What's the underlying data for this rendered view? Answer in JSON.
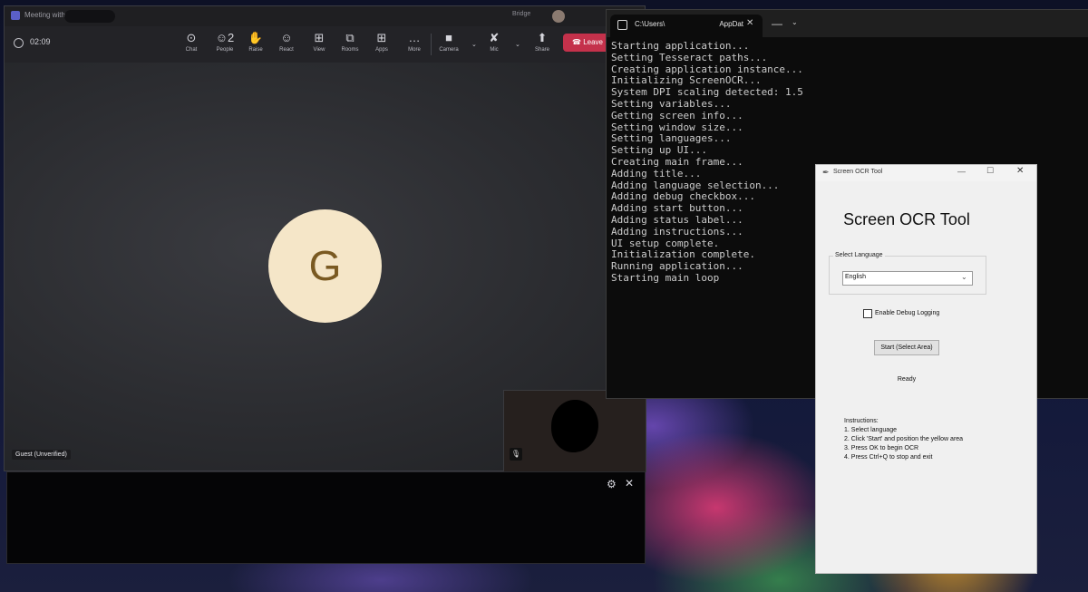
{
  "teams": {
    "window_title": "Meeting with",
    "user_name": "Bridge",
    "timer": "02:09",
    "toolbar": [
      {
        "name": "chat",
        "label": "Chat",
        "icon": "chat-icon",
        "glyph": "⊙"
      },
      {
        "name": "people",
        "label": "People",
        "icon": "people-icon",
        "glyph": "☺2"
      },
      {
        "name": "raise",
        "label": "Raise",
        "icon": "hand-icon",
        "glyph": "✋"
      },
      {
        "name": "react",
        "label": "React",
        "icon": "smiley-icon",
        "glyph": "☺"
      },
      {
        "name": "view",
        "label": "View",
        "icon": "grid-icon",
        "glyph": "⊞"
      },
      {
        "name": "rooms",
        "label": "Rooms",
        "icon": "rooms-icon",
        "glyph": "⧉"
      },
      {
        "name": "apps",
        "label": "Apps",
        "icon": "apps-icon",
        "glyph": "⊞"
      },
      {
        "name": "more",
        "label": "More",
        "icon": "more-icon",
        "glyph": "…"
      },
      {
        "name": "camera",
        "label": "Camera",
        "icon": "camera-icon",
        "glyph": "■"
      },
      {
        "name": "mic",
        "label": "Mic",
        "icon": "mic-off-icon",
        "glyph": "✘"
      },
      {
        "name": "share",
        "label": "Share",
        "icon": "share-icon",
        "glyph": "⬆"
      }
    ],
    "leave_label": "Leave",
    "leave_color": "#c4314b",
    "avatar_initial": "G",
    "participant_label": "Guest (Unverified)",
    "caption_settings_glyph": "⚙",
    "caption_close_glyph": "✕"
  },
  "terminal": {
    "tab_title": "C:\\Users\\",
    "tab_title_suffix": "AppDat",
    "lines": [
      "Starting application...",
      "Setting Tesseract paths...",
      "Creating application instance...",
      "Initializing ScreenOCR...",
      "System DPI scaling detected: 1.5",
      "Setting variables...",
      "Getting screen info...",
      "Setting window size...",
      "Setting languages...",
      "Setting up UI...",
      "Creating main frame...",
      "Adding title...",
      "Adding language selection...",
      "Adding debug checkbox...",
      "Adding start button...",
      "Adding status label...",
      "Adding instructions...",
      "UI setup complete.",
      "Initialization complete.",
      "Running application...",
      "Starting main loop"
    ]
  },
  "ocr": {
    "window_title": "Screen OCR Tool",
    "heading": "Screen OCR Tool",
    "language_group_label": "Select Language",
    "language_value": "English",
    "debug_label": "Enable Debug Logging",
    "start_label": "Start (Select Area)",
    "status": "Ready",
    "instructions_title": "Instructions:",
    "instructions": [
      "1. Select language",
      "2. Click 'Start' and position the yellow area",
      "3. Press OK to begin OCR",
      "4. Press Ctrl+Q to stop and exit"
    ]
  }
}
